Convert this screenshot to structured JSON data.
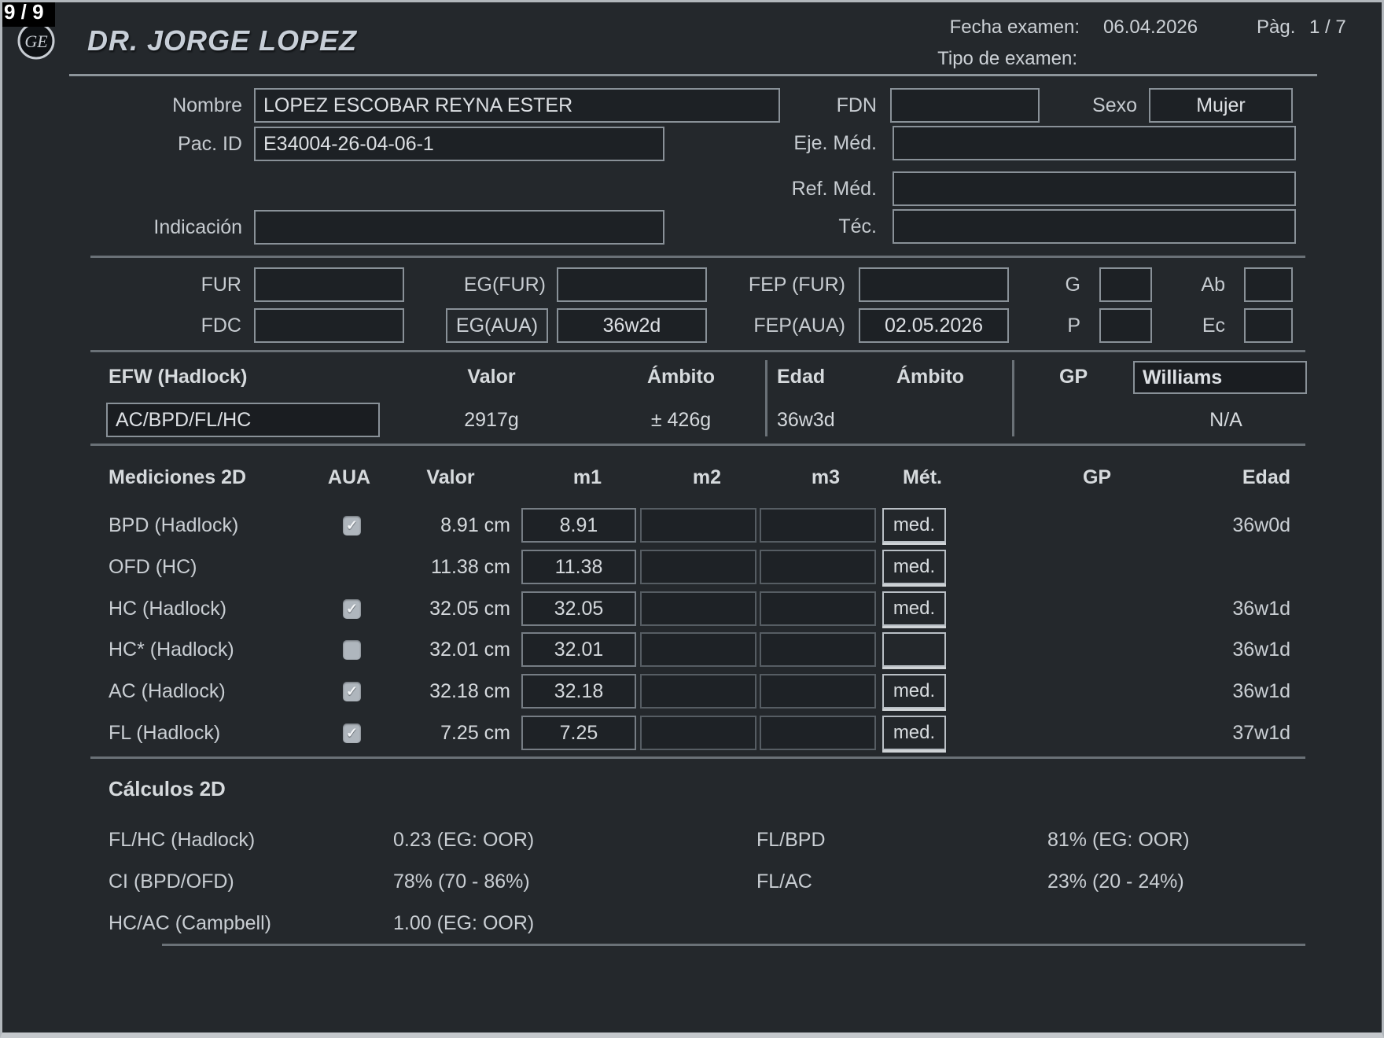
{
  "page_indicator": "9 / 9",
  "header": {
    "doctor": "DR. JORGE LOPEZ",
    "exam_date_label": "Fecha examen:",
    "exam_date": "06.04.2026",
    "page_label": "Pàg.",
    "page_value": "1 / 7",
    "exam_type_label": "Tipo de examen:"
  },
  "patient": {
    "name_label": "Nombre",
    "name": "LOPEZ ESCOBAR REYNA ESTER",
    "id_label": "Pac. ID",
    "id": "E34004-26-04-06-1",
    "birthdate_label": "FDN",
    "birthdate": "",
    "sex_label": "Sexo",
    "sex": "Mujer",
    "performing_md_label": "Eje. Méd.",
    "performing_md": "",
    "referring_md_label": "Ref. Méd.",
    "referring_md": "",
    "indication_label": "Indicación",
    "indication": "",
    "tech_label": "Téc.",
    "tech": ""
  },
  "ob_dates": {
    "fur_label": "FUR",
    "fur": "",
    "eg_fur_label": "EG(FUR)",
    "eg_fur": "",
    "fep_fur_label": "FEP (FUR)",
    "fep_fur": "",
    "g_label": "G",
    "g": "",
    "ab_label": "Ab",
    "ab": "",
    "fdc_label": "FDC",
    "fdc": "",
    "eg_aua_label": "EG(AUA)",
    "eg_aua": "36w2d",
    "fep_aua_label": "FEP(AUA)",
    "fep_aua": "02.05.2026",
    "p_label": "P",
    "p": "",
    "ec_label": "Ec",
    "ec": ""
  },
  "efw": {
    "title": "EFW (Hadlock)",
    "valor_header": "Valor",
    "ambito_header": "Ámbito",
    "edad_header": "Edad",
    "ambito2_header": "Ámbito",
    "gp_header": "GP",
    "gp_method": "Williams",
    "formula": "AC/BPD/FL/HC",
    "valor": "2917g",
    "ambito": "± 426g",
    "edad": "36w3d",
    "gp_value": "N/A"
  },
  "measurements": {
    "title": "Mediciones 2D",
    "aua_header": "AUA",
    "valor_header": "Valor",
    "m1_header": "m1",
    "m2_header": "m2",
    "m3_header": "m3",
    "met_header": "Mét.",
    "gp_header": "GP",
    "edad_header": "Edad",
    "rows": [
      {
        "label": "BPD (Hadlock)",
        "aua": "checked",
        "valor": "8.91 cm",
        "m1": "8.91",
        "m2": "",
        "m3": "",
        "met": "med.",
        "gp": "",
        "edad": "36w0d"
      },
      {
        "label": "OFD (HC)",
        "aua": "none",
        "valor": "11.38 cm",
        "m1": "11.38",
        "m2": "",
        "m3": "",
        "met": "med.",
        "gp": "",
        "edad": ""
      },
      {
        "label": "HC (Hadlock)",
        "aua": "checked",
        "valor": "32.05 cm",
        "m1": "32.05",
        "m2": "",
        "m3": "",
        "met": "med.",
        "gp": "",
        "edad": "36w1d"
      },
      {
        "label": "HC* (Hadlock)",
        "aua": "unchecked",
        "valor": "32.01 cm",
        "m1": "32.01",
        "m2": "",
        "m3": "",
        "met": "",
        "gp": "",
        "edad": "36w1d"
      },
      {
        "label": "AC (Hadlock)",
        "aua": "checked",
        "valor": "32.18 cm",
        "m1": "32.18",
        "m2": "",
        "m3": "",
        "met": "med.",
        "gp": "",
        "edad": "36w1d"
      },
      {
        "label": "FL (Hadlock)",
        "aua": "checked",
        "valor": "7.25 cm",
        "m1": "7.25",
        "m2": "",
        "m3": "",
        "met": "med.",
        "gp": "",
        "edad": "37w1d"
      }
    ]
  },
  "calculations": {
    "title": "Cálculos 2D",
    "left": [
      {
        "label": "FL/HC (Hadlock)",
        "value": "0.23 (EG: OOR)"
      },
      {
        "label": "CI (BPD/OFD)",
        "value": "78% (70 - 86%)"
      },
      {
        "label": "HC/AC (Campbell)",
        "value": "1.00 (EG: OOR)"
      }
    ],
    "right": [
      {
        "label": "FL/BPD",
        "value": "81% (EG: OOR)"
      },
      {
        "label": "FL/AC",
        "value": "23% (20 - 24%)"
      }
    ]
  },
  "colors": {
    "background": "#24282c",
    "field_background": "#1d2125",
    "field_border": "#899198",
    "text": "#c9ced3",
    "divider": "#6a7177"
  }
}
